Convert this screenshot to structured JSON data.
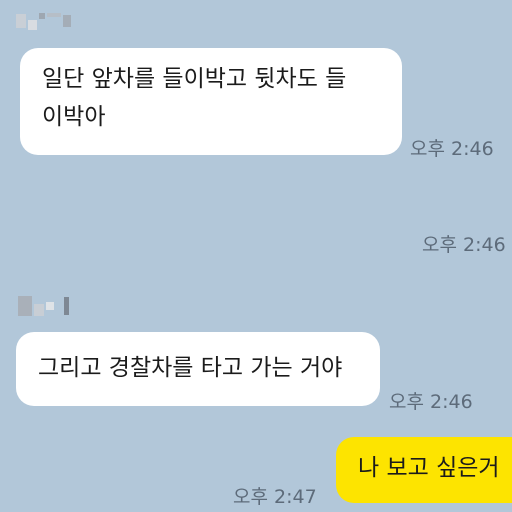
{
  "messages": [
    {
      "direction": "incoming",
      "text_line1": "일단 앞차를 들이박고 뒷차도 들",
      "text_line2": "이박아",
      "time": "오후 2:46"
    },
    {
      "direction": "incoming",
      "time": "오후 2:46"
    },
    {
      "direction": "incoming",
      "text": "그리고 경찰차를 타고 가는 거야",
      "time": "오후 2:46"
    },
    {
      "direction": "outgoing",
      "text": "나 보고 싶은거"
    }
  ],
  "extra_time": "오후 2:47",
  "colors": {
    "background": "#b2c7d9",
    "incoming_bubble": "#ffffff",
    "outgoing_bubble": "#fde400",
    "time_text": "#5d6b7a"
  }
}
